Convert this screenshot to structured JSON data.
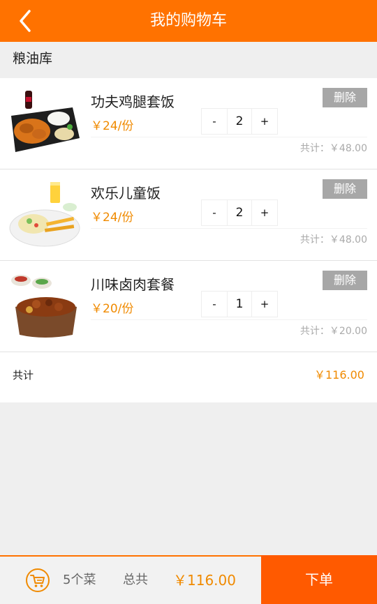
{
  "header": {
    "title": "我的购物车",
    "back_icon": "chevron-left-icon"
  },
  "store": {
    "name": "粮油库"
  },
  "items": [
    {
      "name": "功夫鸡腿套饭",
      "price": "￥24/份",
      "qty": "2",
      "minus": "-",
      "plus": "+",
      "delete_label": "删除",
      "subtotal": "共计：￥48.00"
    },
    {
      "name": "欢乐儿童饭",
      "price": "￥24/份",
      "qty": "2",
      "minus": "-",
      "plus": "+",
      "delete_label": "删除",
      "subtotal": "共计：￥48.00"
    },
    {
      "name": "川味卤肉套餐",
      "price": "￥20/份",
      "qty": "1",
      "minus": "-",
      "plus": "+",
      "delete_label": "删除",
      "subtotal": "共计：￥20.00"
    }
  ],
  "summary": {
    "label": "共计",
    "amount": "￥116.00"
  },
  "footer": {
    "cart_icon": "cart-icon",
    "count": "5个菜",
    "total_label": "总共",
    "total_amount": "￥116.00",
    "order_label": "下单"
  },
  "colors": {
    "brand": "#ff7200",
    "order_button": "#ff5a00",
    "price": "#f08a00",
    "delete_button": "#a7a7a7"
  }
}
